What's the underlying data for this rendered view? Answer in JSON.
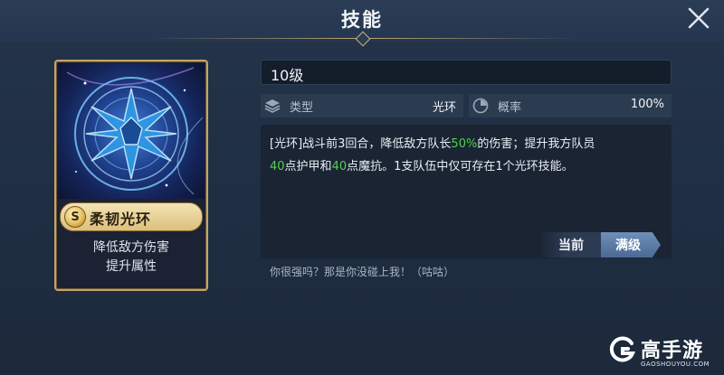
{
  "header": {
    "title": "技能"
  },
  "card": {
    "rank": "S",
    "name": "柔韧光环",
    "desc_line1": "降低敌方伤害",
    "desc_line2": "提升属性"
  },
  "skill": {
    "level": "10级",
    "type_label": "类型",
    "type_value": "光环",
    "rate_label": "概率",
    "rate_value": "100%",
    "desc": {
      "p1": "[光环]战斗前3回合，降低敌方队长",
      "h1": "50%",
      "p2": "的伤害；提升我方队员",
      "h2": "40",
      "p3": "点护甲和",
      "h3": "40",
      "p4": "点魔抗。1支队伍中仅可存在1个光环技能。"
    },
    "highlight_color": "#4fd24a"
  },
  "buttons": {
    "current": "当前",
    "max": "满级"
  },
  "quote": "你很强吗？那是你没碰上我！（咕咕）",
  "watermark": {
    "name": "高手游",
    "url": "GAOSHOUYOU.COM"
  },
  "icons": {
    "close": "close-icon",
    "type": "layers-icon",
    "rate": "dial-icon"
  }
}
